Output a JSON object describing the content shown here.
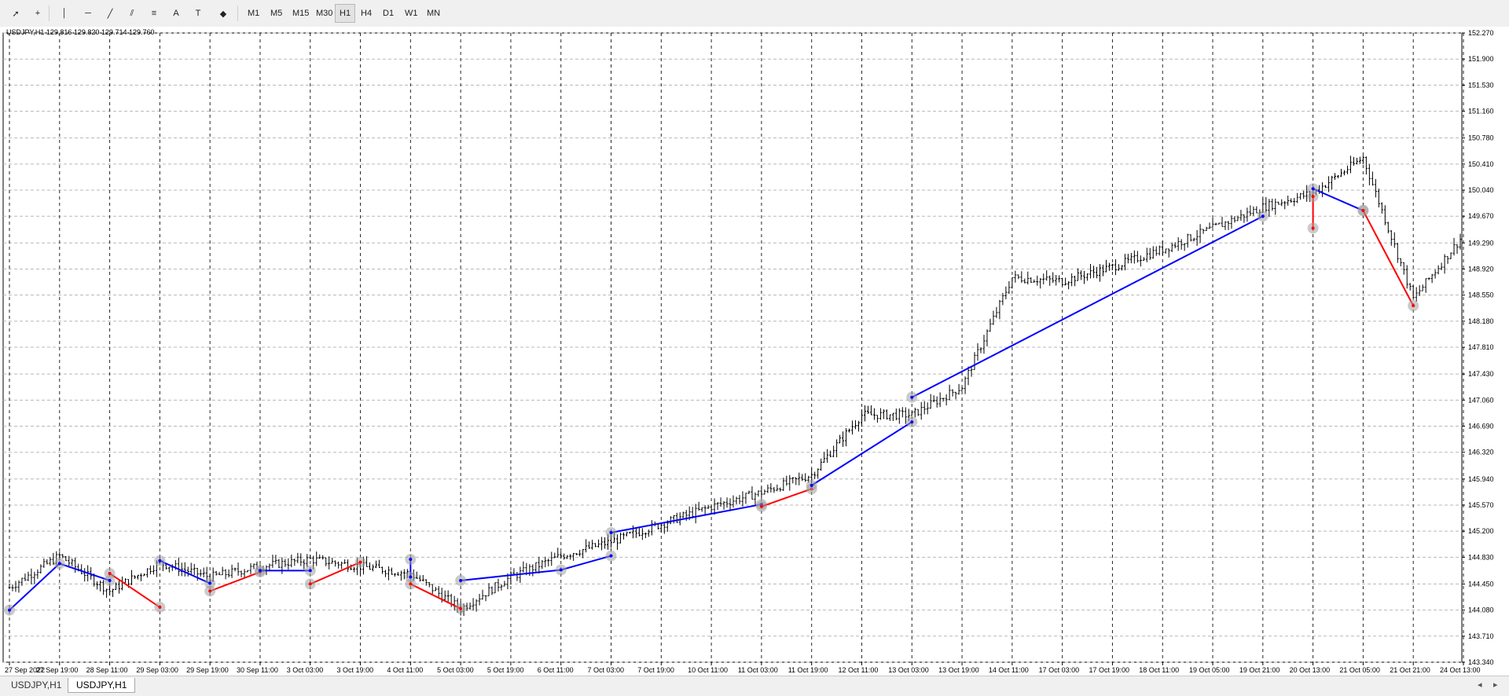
{
  "toolbar": {
    "tools": [
      "cursor-icon",
      "crosshair-icon",
      "vertical-line-icon",
      "horizontal-line-icon",
      "trendline-icon",
      "channel-icon",
      "fibonacci-icon",
      "text-icon",
      "label-icon",
      "shapes-icon"
    ],
    "timeframes": [
      "M1",
      "M5",
      "M15",
      "M30",
      "H1",
      "H4",
      "D1",
      "W1",
      "MN"
    ],
    "active_timeframe": "H1"
  },
  "chart": {
    "info_text": "USDJPY,H1  129.816 129.820 129.714 129.760"
  },
  "tabs": [
    "USDJPY,H1",
    "USDJPY,H1"
  ],
  "active_tab": 1,
  "colors": {
    "bars": "#000000",
    "up_zigzag": "#0000ff",
    "down_zigzag": "#ff0000",
    "grid": "#b8b8b8",
    "marker": "#a0a0a0"
  },
  "chart_data": {
    "type": "candlestick",
    "symbol": "USDJPY",
    "timeframe": "H1",
    "ylim": [
      143.34,
      152.27
    ],
    "y_ticks": [
      "152.270",
      "151.900",
      "151.530",
      "151.160",
      "150.780",
      "150.410",
      "150.040",
      "149.670",
      "149.290",
      "148.920",
      "148.550",
      "148.180",
      "147.810",
      "147.430",
      "147.060",
      "146.690",
      "146.320",
      "145.940",
      "145.570",
      "145.200",
      "144.830",
      "144.450",
      "144.080",
      "143.710",
      "143.340"
    ],
    "x_labels": [
      "27 Sep 2022",
      "27 Sep 19:00",
      "28 Sep 11:00",
      "29 Sep 03:00",
      "29 Sep 19:00",
      "30 Sep 11:00",
      "3 Oct 03:00",
      "3 Oct 19:00",
      "4 Oct 11:00",
      "5 Oct 03:00",
      "5 Oct 19:00",
      "6 Oct 11:00",
      "7 Oct 03:00",
      "7 Oct 19:00",
      "10 Oct 11:00",
      "11 Oct 03:00",
      "11 Oct 19:00",
      "12 Oct 11:00",
      "13 Oct 03:00",
      "13 Oct 19:00",
      "14 Oct 11:00",
      "17 Oct 03:00",
      "17 Oct 19:00",
      "18 Oct 11:00",
      "19 Oct 05:00",
      "19 Oct 21:00",
      "20 Oct 13:00",
      "21 Oct 05:00",
      "21 Oct 21:00",
      "24 Oct 13:00"
    ],
    "series": [
      {
        "name": "price",
        "x": [
          "27 Sep 2022",
          "27 Sep 19:00",
          "28 Sep 11:00",
          "29 Sep 03:00",
          "29 Sep 19:00",
          "30 Sep 11:00",
          "3 Oct 03:00",
          "3 Oct 19:00",
          "4 Oct 11:00",
          "5 Oct 03:00",
          "5 Oct 19:00",
          "6 Oct 11:00",
          "7 Oct 03:00",
          "7 Oct 19:00",
          "10 Oct 11:00",
          "11 Oct 03:00",
          "11 Oct 19:00",
          "12 Oct 11:00",
          "13 Oct 03:00",
          "13 Oct 19:00",
          "14 Oct 11:00",
          "17 Oct 03:00",
          "17 Oct 19:00",
          "18 Oct 11:00",
          "19 Oct 05:00",
          "19 Oct 21:00",
          "20 Oct 13:00",
          "21 Oct 05:00",
          "21 Oct 21:00",
          "24 Oct 13:00"
        ],
        "values": [
          144.4,
          144.85,
          144.35,
          144.75,
          144.55,
          144.7,
          144.8,
          144.7,
          144.6,
          144.1,
          144.55,
          144.85,
          145.05,
          145.3,
          145.55,
          145.75,
          146.0,
          146.85,
          146.85,
          147.25,
          148.8,
          148.75,
          148.95,
          149.2,
          149.5,
          149.8,
          150.0,
          150.5,
          148.5,
          149.4
        ]
      }
    ],
    "zigzag": [
      {
        "color": "blue",
        "points": [
          [
            "27 Sep 2022",
            144.08
          ],
          [
            "27 Sep 19:00",
            144.74
          ],
          [
            "28 Sep 11:00",
            144.5
          ]
        ]
      },
      {
        "color": "red",
        "points": [
          [
            "28 Sep 11:00",
            144.6
          ],
          [
            "29 Sep 03:00",
            144.12
          ]
        ]
      },
      {
        "color": "blue",
        "points": [
          [
            "29 Sep 03:00",
            144.78
          ],
          [
            "29 Sep 19:00",
            144.46
          ]
        ]
      },
      {
        "color": "red",
        "points": [
          [
            "29 Sep 19:00",
            144.35
          ],
          [
            "30 Sep 11:00",
            144.62
          ]
        ]
      },
      {
        "color": "blue",
        "points": [
          [
            "30 Sep 11:00",
            144.64
          ],
          [
            "3 Oct 03:00",
            144.64
          ]
        ]
      },
      {
        "color": "red",
        "points": [
          [
            "3 Oct 03:00",
            144.45
          ],
          [
            "3 Oct 19:00",
            144.76
          ]
        ]
      },
      {
        "color": "blue",
        "points": [
          [
            "4 Oct 11:00",
            144.8
          ],
          [
            "4 Oct 11:00",
            144.55
          ]
        ]
      },
      {
        "color": "red",
        "points": [
          [
            "4 Oct 11:00",
            144.45
          ],
          [
            "5 Oct 03:00",
            144.1
          ]
        ]
      },
      {
        "color": "blue",
        "points": [
          [
            "5 Oct 03:00",
            144.5
          ],
          [
            "6 Oct 11:00",
            144.65
          ],
          [
            "7 Oct 03:00",
            144.85
          ]
        ]
      },
      {
        "color": "blue",
        "points": [
          [
            "7 Oct 03:00",
            145.18
          ],
          [
            "11 Oct 03:00",
            145.58
          ]
        ]
      },
      {
        "color": "red",
        "points": [
          [
            "11 Oct 03:00",
            145.55
          ],
          [
            "11 Oct 19:00",
            145.8
          ]
        ]
      },
      {
        "color": "blue",
        "points": [
          [
            "11 Oct 19:00",
            145.85
          ],
          [
            "13 Oct 03:00",
            146.75
          ]
        ]
      },
      {
        "color": "blue",
        "points": [
          [
            "13 Oct 03:00",
            147.1
          ],
          [
            "19 Oct 21:00",
            149.67
          ]
        ]
      },
      {
        "color": "red",
        "points": [
          [
            "20 Oct 13:00",
            149.5
          ],
          [
            "20 Oct 13:00",
            149.95
          ]
        ]
      },
      {
        "color": "blue",
        "points": [
          [
            "20 Oct 13:00",
            150.06
          ],
          [
            "21 Oct 05:00",
            149.75
          ]
        ]
      },
      {
        "color": "red",
        "points": [
          [
            "21 Oct 05:00",
            149.75
          ],
          [
            "21 Oct 21:00",
            148.4
          ]
        ]
      }
    ],
    "grid": true
  }
}
